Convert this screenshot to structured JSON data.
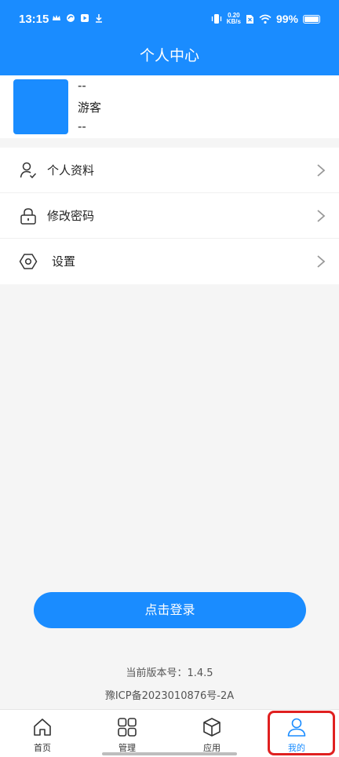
{
  "status_bar": {
    "time": "13:15",
    "net_speed_value": "0.20",
    "net_speed_unit": "KB/s",
    "battery_text": "99%",
    "battery_level": 0.99
  },
  "header": {
    "title": "个人中心"
  },
  "profile": {
    "line1": "--",
    "name": "游客",
    "line3": "--"
  },
  "menu": {
    "items": [
      {
        "label": "个人资料",
        "icon": "user-check-icon"
      },
      {
        "label": "修改密码",
        "icon": "lock-icon"
      },
      {
        "label": "设置",
        "icon": "hexagon-settings-icon"
      }
    ]
  },
  "login_button": {
    "label": "点击登录"
  },
  "footer": {
    "version": "当前版本号：1.4.5",
    "icp": "豫ICP备2023010876号-2A"
  },
  "tabbar": {
    "tabs": [
      {
        "label": "首页",
        "icon": "home-icon"
      },
      {
        "label": "管理",
        "icon": "grid-icon"
      },
      {
        "label": "应用",
        "icon": "box-icon"
      },
      {
        "label": "我的",
        "icon": "user-icon"
      }
    ],
    "active_index": 3
  },
  "colors": {
    "primary": "#1a8cff",
    "highlight": "#e02020",
    "background": "#f5f5f5"
  }
}
